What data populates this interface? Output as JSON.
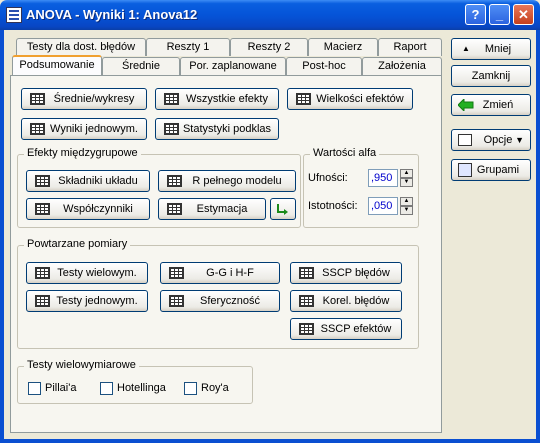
{
  "window": {
    "title": "ANOVA - Wyniki 1: Anova12",
    "help_glyph": "?",
    "minimize_glyph": "_",
    "close_glyph": "✕"
  },
  "tabs_row1": [
    "Testy dla dost. błędów",
    "Reszty 1",
    "Reszty 2",
    "Macierz",
    "Raport"
  ],
  "tabs_row2": [
    "Podsumowanie",
    "Średnie",
    "Por. zaplanowane",
    "Post-hoc",
    "Założenia"
  ],
  "active_tab": "Podsumowanie",
  "top_buttons": {
    "srednie_wykresy": "Średnie/wykresy",
    "wszystkie_efekty": "Wszystkie efekty",
    "wielkosci_efektow": "Wielkości efektów",
    "wyniki_jednowym": "Wyniki jednowym.",
    "statystyki_podklas": "Statystyki podklas"
  },
  "between_group": {
    "title": "Efekty międzygrupowe",
    "skladniki_ukladu": "Składniki układu",
    "r_pelnego_modelu": "R pełnego modelu",
    "wspolczynniki": "Współczynniki",
    "estymacja": "Estymacja"
  },
  "alpha": {
    "title": "Wartości alfa",
    "ufnosci_label": "Ufności:",
    "ufnosci_value": ",950",
    "istotnosci_label": "Istotności:",
    "istotnosci_value": ",050",
    "spin_up": "▲",
    "spin_down": "▼"
  },
  "repeated": {
    "title": "Powtarzane pomiary",
    "testy_wielowym": "Testy wielowym.",
    "gg_hf": "G-G i H-F",
    "sscp_bledow": "SSCP błędów",
    "testy_jednowym": "Testy jednowym.",
    "sferycznosc": "Sferyczność",
    "korel_bledow": "Korel. błędów",
    "sscp_efektow": "SSCP efektów"
  },
  "multivariate": {
    "title": "Testy wielowymiarowe",
    "pillai": "Pillai'a",
    "hotelling": "Hotellinga",
    "roy": "Roy'a"
  },
  "side": {
    "mniej": "Mniej",
    "zamknij": "Zamknij",
    "zmien": "Zmień",
    "opcje": "Opcje",
    "grupami": "Grupami"
  }
}
